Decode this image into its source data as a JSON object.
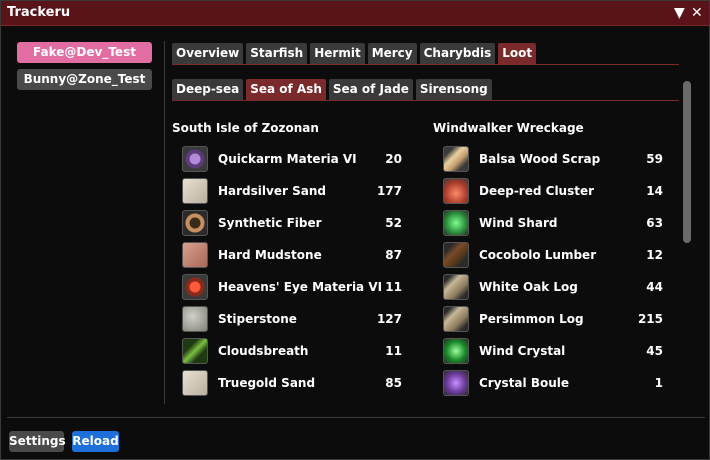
{
  "window": {
    "title": "Trackeru",
    "collapse_glyph": "▼",
    "close_glyph": "✕"
  },
  "accounts": [
    "Fake@Dev_Test",
    "Bunny@Zone_Test"
  ],
  "tabs": [
    "Overview",
    "Starfish",
    "Hermit",
    "Mercy",
    "Charybdis",
    "Loot"
  ],
  "subtabs": [
    "Deep-sea",
    "Sea of Ash",
    "Sea of Jade",
    "Sirensong"
  ],
  "columns": [
    {
      "title": "South Isle of Zozonan",
      "items": [
        {
          "name": "Quickarm Materia VI",
          "qty": "20",
          "icon": "materia-purple-icon"
        },
        {
          "name": "Hardsilver Sand",
          "qty": "177",
          "icon": "sand-icon"
        },
        {
          "name": "Synthetic Fiber",
          "qty": "52",
          "icon": "fiber-ring-icon"
        },
        {
          "name": "Hard Mudstone",
          "qty": "87",
          "icon": "mudstone-icon"
        },
        {
          "name": "Heavens' Eye Materia VI",
          "qty": "11",
          "icon": "materia-red-icon"
        },
        {
          "name": "Stiperstone",
          "qty": "127",
          "icon": "stone-icon"
        },
        {
          "name": "Cloudsbreath",
          "qty": "11",
          "icon": "leaf-icon"
        },
        {
          "name": "Truegold Sand",
          "qty": "85",
          "icon": "sand-icon"
        }
      ]
    },
    {
      "title": "Windwalker Wreckage",
      "items": [
        {
          "name": "Balsa Wood Scrap",
          "qty": "59",
          "icon": "wood-scrap-icon"
        },
        {
          "name": "Deep-red Cluster",
          "qty": "14",
          "icon": "red-cluster-icon"
        },
        {
          "name": "Wind Shard",
          "qty": "63",
          "icon": "wind-shard-icon"
        },
        {
          "name": "Cocobolo Lumber",
          "qty": "12",
          "icon": "lumber-icon"
        },
        {
          "name": "White Oak Log",
          "qty": "44",
          "icon": "log-icon"
        },
        {
          "name": "Persimmon Log",
          "qty": "215",
          "icon": "log-icon"
        },
        {
          "name": "Wind Crystal",
          "qty": "45",
          "icon": "wind-crystal-icon"
        },
        {
          "name": "Crystal Boule",
          "qty": "1",
          "icon": "crystal-boule-icon"
        }
      ]
    }
  ],
  "footer": {
    "settings": "Settings",
    "reload": "Reload"
  },
  "colors": {
    "accent": "#7a2a2a",
    "account_active": "#e16da3",
    "reload": "#1e6fd9"
  }
}
